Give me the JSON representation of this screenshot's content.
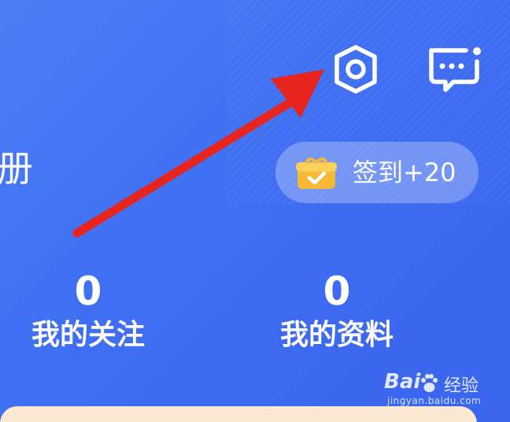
{
  "header": {
    "partial_title": "册",
    "settings_icon": "gear-icon",
    "messages_icon": "message-icon"
  },
  "checkin": {
    "label": "签到+20",
    "icon": "gift-icon"
  },
  "stats": [
    {
      "count": "0",
      "label": "我的关注"
    },
    {
      "count": "0",
      "label": "我的资料"
    }
  ],
  "annotation": {
    "arrow_color": "#e8241e",
    "points_to": "settings-button"
  },
  "watermark": {
    "brand": "Bai",
    "brand_cn": "经验",
    "url": "jingyan.baidu.com"
  },
  "colors": {
    "background": "#4474f4",
    "card": "#fbe9d3",
    "gift": "#f5b935"
  }
}
